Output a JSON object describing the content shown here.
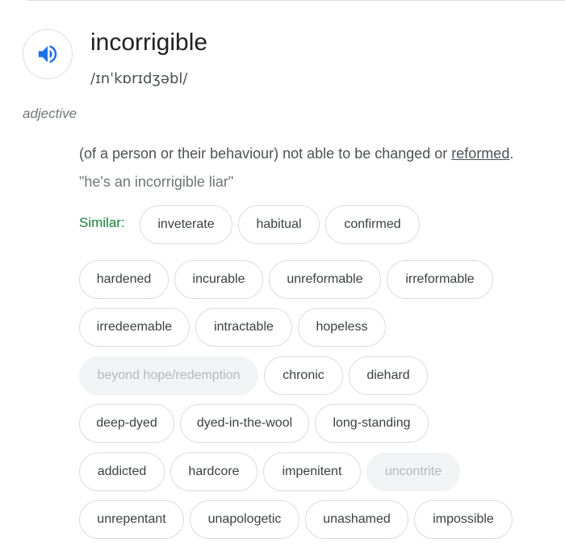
{
  "entry": {
    "word": "incorrigible",
    "phonetic": "/ɪnˈkɒrɪdʒəbl/",
    "part_of_speech": "adjective",
    "definition_before": "(of a person or their behaviour) not able to be changed or ",
    "definition_link": "reformed",
    "definition_after": ".",
    "example": "\"he's an incorrigible liar\"",
    "similar_label": "Similar:",
    "speaker_icon": "volume-up-icon",
    "accent_color": "#1a73e8",
    "similar_color": "#188038"
  },
  "synonyms": [
    {
      "label": "inveterate",
      "disabled": false
    },
    {
      "label": "habitual",
      "disabled": false
    },
    {
      "label": "confirmed",
      "disabled": false
    },
    {
      "label": "hardened",
      "disabled": false
    },
    {
      "label": "incurable",
      "disabled": false
    },
    {
      "label": "unreformable",
      "disabled": false
    },
    {
      "label": "irreformable",
      "disabled": false
    },
    {
      "label": "irredeemable",
      "disabled": false
    },
    {
      "label": "intractable",
      "disabled": false
    },
    {
      "label": "hopeless",
      "disabled": false
    },
    {
      "label": "beyond hope/redemption",
      "disabled": true
    },
    {
      "label": "chronic",
      "disabled": false
    },
    {
      "label": "diehard",
      "disabled": false
    },
    {
      "label": "deep-dyed",
      "disabled": false
    },
    {
      "label": "dyed-in-the-wool",
      "disabled": false
    },
    {
      "label": "long-standing",
      "disabled": false
    },
    {
      "label": "addicted",
      "disabled": false
    },
    {
      "label": "hardcore",
      "disabled": false
    },
    {
      "label": "impenitent",
      "disabled": false
    },
    {
      "label": "uncontrite",
      "disabled": true
    },
    {
      "label": "unrepentant",
      "disabled": false
    },
    {
      "label": "unapologetic",
      "disabled": false
    },
    {
      "label": "unashamed",
      "disabled": false
    },
    {
      "label": "impossible",
      "disabled": false
    }
  ]
}
